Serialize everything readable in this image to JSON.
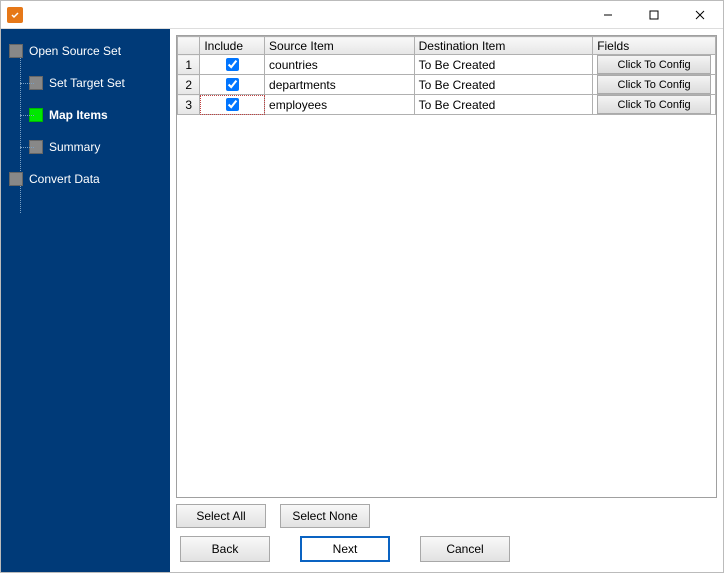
{
  "window": {
    "title": ""
  },
  "sidebar": {
    "items": [
      {
        "label": "Open Source Set",
        "active": false,
        "child": false
      },
      {
        "label": "Set Target Set",
        "active": false,
        "child": true
      },
      {
        "label": "Map Items",
        "active": true,
        "child": true
      },
      {
        "label": "Summary",
        "active": false,
        "child": true
      },
      {
        "label": "Convert Data",
        "active": false,
        "child": false
      }
    ]
  },
  "grid": {
    "headers": {
      "include": "Include",
      "source": "Source Item",
      "dest": "Destination Item",
      "fields": "Fields"
    },
    "config_button_label": "Click To Config",
    "rows": [
      {
        "n": "1",
        "include": true,
        "source": "countries",
        "dest": "To Be Created"
      },
      {
        "n": "2",
        "include": true,
        "source": "departments",
        "dest": "To Be Created"
      },
      {
        "n": "3",
        "include": true,
        "source": "employees",
        "dest": "To Be Created"
      }
    ]
  },
  "buttons": {
    "select_all": "Select All",
    "select_none": "Select None",
    "back": "Back",
    "next": "Next",
    "cancel": "Cancel"
  }
}
